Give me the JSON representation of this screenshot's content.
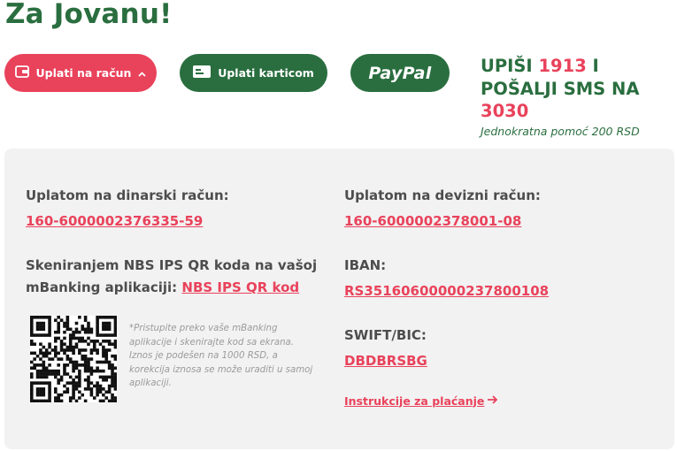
{
  "title": "Za Jovanu!",
  "buttons": {
    "bank": "Uplati na račun",
    "card": "Uplati karticom",
    "paypal": "PayPal"
  },
  "sms": {
    "prefix1": "UPIŠI ",
    "code": "1913",
    "suffix1": " I",
    "line2": "POŠALJI SMS NA",
    "number": "3030",
    "subtitle": "Jednokratna pomoć 200 RSD"
  },
  "left": {
    "dinar_label": "Uplatom na dinarski račun:",
    "dinar_account": "160-6000002376335-59",
    "qr_label_1": "Skeniranjem NBS IPS QR koda na vašoj",
    "qr_label_2": "mBanking aplikaciji: ",
    "qr_link": "NBS IPS QR kod",
    "qr_note": "*Pristupite preko vaše mBanking aplikacije i skenirajte kod sa ekrana. Iznos je podešen na 1000 RSD, a korekcija iznosa se može uraditi u samoj aplikaciji."
  },
  "right": {
    "foreign_label": "Uplatom na devizni račun:",
    "foreign_account": "160-6000002378001-08",
    "iban_label": "IBAN:",
    "iban": "RS35160600000237800108",
    "swift_label": "SWIFT/BIC:",
    "swift": "DBDBRSBG",
    "instructions": "Instrukcije za plaćanje"
  },
  "colors": {
    "brand_green": "#2a6e3f",
    "accent_red": "#e9425b",
    "panel_bg": "#f2f2f2"
  },
  "icons": {
    "bank_button": "wallet-icon",
    "bank_toggle": "chevron-up-icon",
    "card_button": "credit-card-icon",
    "instructions": "arrow-right-icon"
  }
}
